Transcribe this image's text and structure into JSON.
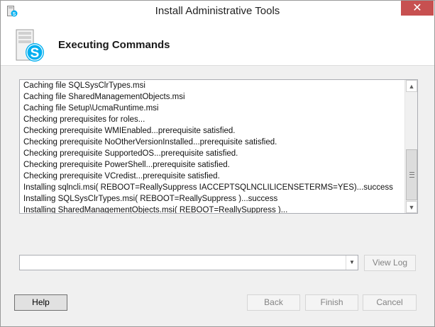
{
  "window": {
    "title": "Install Administrative Tools",
    "close_label": "✕"
  },
  "header": {
    "title": "Executing Commands"
  },
  "log": {
    "lines": [
      "Caching file SQLSysClrTypes.msi",
      "Caching file SharedManagementObjects.msi",
      "Caching file Setup\\UcmaRuntime.msi",
      "Checking prerequisites for roles...",
      "Checking prerequisite WMIEnabled...prerequisite satisfied.",
      "Checking prerequisite NoOtherVersionInstalled...prerequisite satisfied.",
      "Checking prerequisite SupportedOS...prerequisite satisfied.",
      "Checking prerequisite PowerShell...prerequisite satisfied.",
      "Checking prerequisite VCredist...prerequisite satisfied.",
      "Installing sqlncli.msi( REBOOT=ReallySuppress IACCEPTSQLNCLILICENSETERMS=YES)...success",
      "Installing SQLSysClrTypes.msi( REBOOT=ReallySuppress )...success",
      "Installing SharedManagementObjects.msi( REBOOT=ReallySuppress )..."
    ],
    "scroll_up_glyph": "▲",
    "scroll_down_glyph": "▼"
  },
  "log_selector": {
    "value": "",
    "dropdown_glyph": "▼"
  },
  "buttons": {
    "view_log": "View Log",
    "help": "Help",
    "back": "Back",
    "finish": "Finish",
    "cancel": "Cancel"
  },
  "icons": {
    "title": "skype-setup-icon",
    "header": "skype-server-logo-icon"
  },
  "colors": {
    "close_button": "#c75050",
    "skype_blue": "#00aff0",
    "disabled_text": "#838383"
  }
}
